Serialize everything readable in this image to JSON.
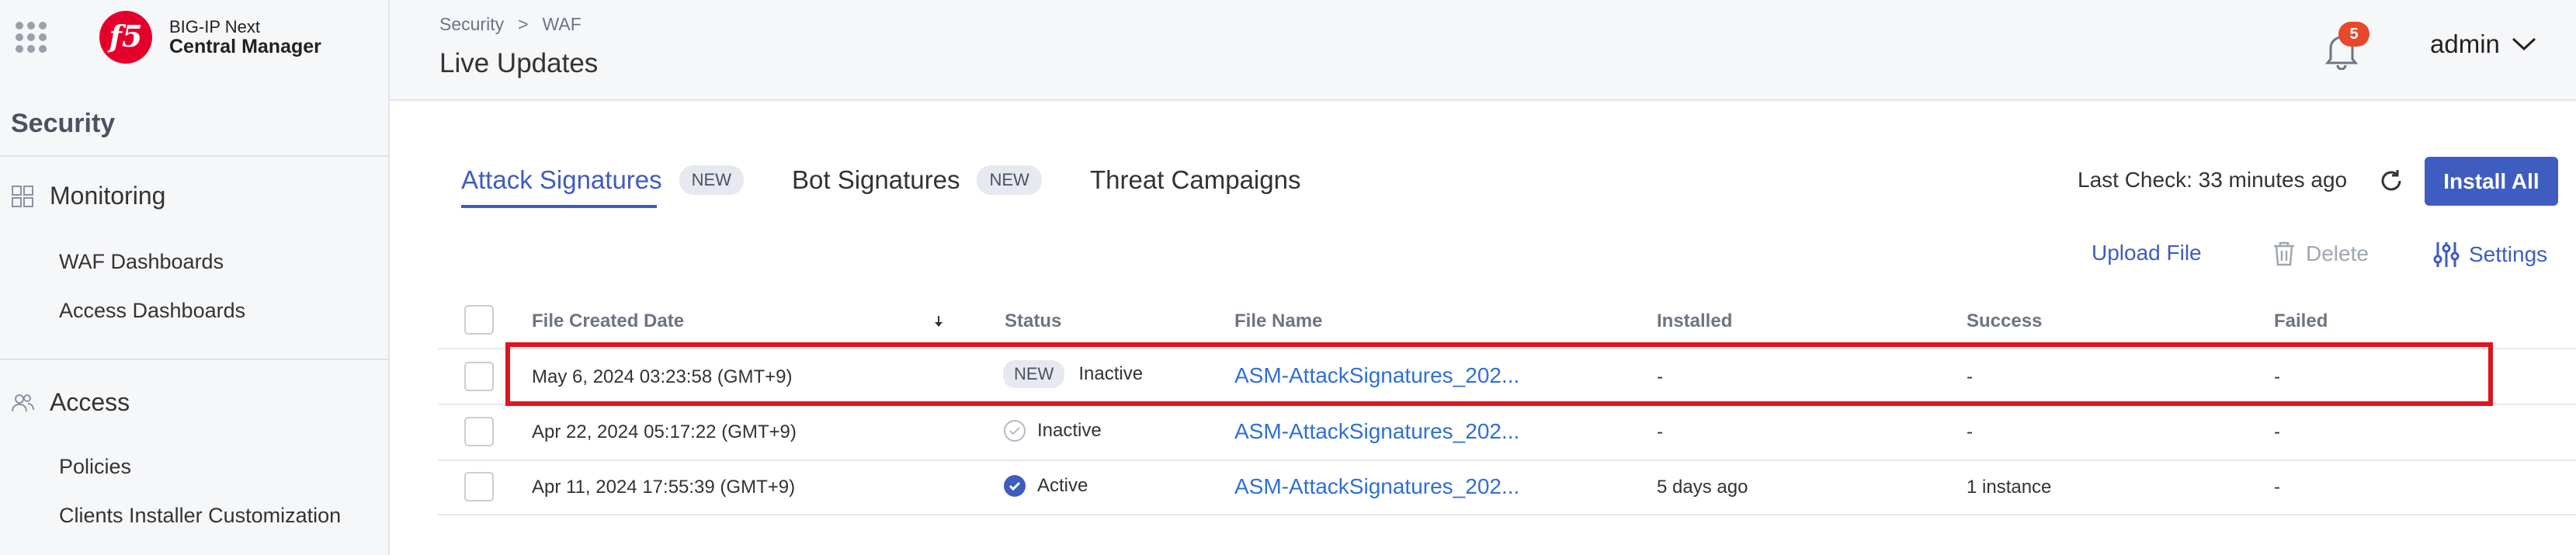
{
  "brand": {
    "line1": "BIG-IP Next",
    "line2": "Central Manager",
    "logo_text": "f5"
  },
  "sidebar": {
    "section_title": "Security",
    "groups": [
      {
        "label": "Monitoring",
        "icon": "dashboard-icon",
        "items": [
          "WAF Dashboards",
          "Access Dashboards"
        ]
      },
      {
        "label": "Access",
        "icon": "users-icon",
        "items": [
          "Policies",
          "Clients Installer Customization"
        ]
      }
    ]
  },
  "header": {
    "breadcrumb": [
      "Security",
      "WAF"
    ],
    "breadcrumb_sep": ">",
    "title": "Live Updates",
    "notifications_count": "5",
    "user": "admin"
  },
  "tabs": [
    {
      "label": "Attack Signatures",
      "badge": "NEW",
      "active": true
    },
    {
      "label": "Bot Signatures",
      "badge": "NEW",
      "active": false
    },
    {
      "label": "Threat Campaigns",
      "badge": "",
      "active": false
    }
  ],
  "toolbar": {
    "last_check": "Last Check: 33 minutes ago",
    "install_all": "Install All",
    "upload_file": "Upload File",
    "delete": "Delete",
    "settings": "Settings"
  },
  "table": {
    "columns": [
      "File Created Date",
      "Status",
      "File Name",
      "Installed",
      "Success",
      "Failed"
    ],
    "sorted_column": "File Created Date",
    "rows": [
      {
        "date": "May 6, 2024 03:23:58 (GMT+9)",
        "badge": "NEW",
        "status": "Inactive",
        "file": "ASM-AttackSignatures_202...",
        "installed": "-",
        "success": "-",
        "failed": "-",
        "highlighted": true
      },
      {
        "date": "Apr 22, 2024 05:17:22 (GMT+9)",
        "badge": "",
        "status": "Inactive",
        "file": "ASM-AttackSignatures_202...",
        "installed": "-",
        "success": "-",
        "failed": "-",
        "highlighted": false
      },
      {
        "date": "Apr 11, 2024 17:55:39 (GMT+9)",
        "badge": "",
        "status": "Active",
        "file": "ASM-AttackSignatures_202...",
        "installed": "5 days ago",
        "success": "1 instance",
        "failed": "-",
        "highlighted": false
      }
    ]
  },
  "colors": {
    "accent": "#3f5cc0",
    "link": "#2f6fd6",
    "highlight": "#e0141e",
    "badge": "#e8472b"
  }
}
